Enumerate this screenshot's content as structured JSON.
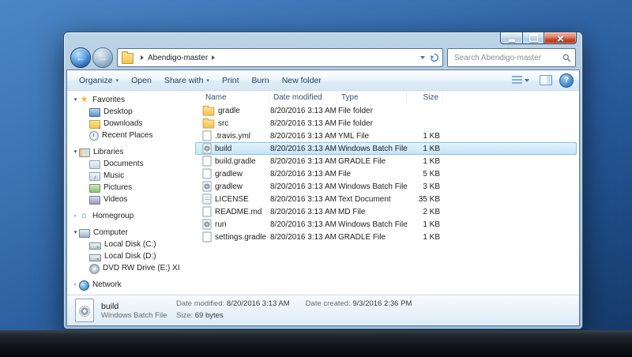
{
  "theme": {
    "desktop_top": "#4a86c6",
    "desktop_bottom": "#143763",
    "window_glass": "#a7c4da",
    "selection_fill": "#c5e5f8",
    "selection_border": "#8ac2e8",
    "close_button_red": "#cf4f30",
    "taskbar_dark": "#0a0f14"
  },
  "navbar": {
    "breadcrumb_item": "Abendigo-master",
    "search_placeholder": "Search Abendigo-master"
  },
  "commandbar": {
    "items": [
      {
        "label": "Organize",
        "dropdown": true
      },
      {
        "label": "Open",
        "dropdown": false
      },
      {
        "label": "Share with",
        "dropdown": true
      },
      {
        "label": "Print",
        "dropdown": false
      },
      {
        "label": "Burn",
        "dropdown": false
      },
      {
        "label": "New folder",
        "dropdown": false
      }
    ],
    "help_label": "?"
  },
  "sidebar": {
    "items": [
      {
        "label": "Favorites",
        "level": 0,
        "icon": "star",
        "expander": "expanded"
      },
      {
        "label": "Desktop",
        "level": 1,
        "icon": "desktop"
      },
      {
        "label": "Downloads",
        "level": 1,
        "icon": "downloads"
      },
      {
        "label": "Recent Places",
        "level": 1,
        "icon": "recent"
      },
      {
        "label": "Libraries",
        "level": 0,
        "icon": "libraries",
        "expander": "expanded"
      },
      {
        "label": "Documents",
        "level": 1,
        "icon": "documents"
      },
      {
        "label": "Music",
        "level": 1,
        "icon": "music"
      },
      {
        "label": "Pictures",
        "level": 1,
        "icon": "pictures"
      },
      {
        "label": "Videos",
        "level": 1,
        "icon": "videos"
      },
      {
        "label": "Homegroup",
        "level": 0,
        "icon": "homegroup",
        "expander": "collapsed"
      },
      {
        "label": "Computer",
        "level": 0,
        "icon": "computer",
        "expander": "expanded"
      },
      {
        "label": "Local Disk (C:)",
        "level": 1,
        "icon": "drive"
      },
      {
        "label": "Local Disk (D:)",
        "level": 1,
        "icon": "drive"
      },
      {
        "label": "DVD RW Drive (E:) XI",
        "level": 1,
        "icon": "dvd"
      },
      {
        "label": "Network",
        "level": 0,
        "icon": "network",
        "expander": "collapsed"
      }
    ]
  },
  "filelist": {
    "columns": [
      {
        "label": "Name"
      },
      {
        "label": "Date modified"
      },
      {
        "label": "Type"
      },
      {
        "label": "Size"
      }
    ],
    "rows": [
      {
        "name": "gradle",
        "date": "8/20/2016 3:13 AM",
        "type": "File folder",
        "size": "",
        "icon": "folder",
        "selected": false
      },
      {
        "name": "src",
        "date": "8/20/2016 3:13 AM",
        "type": "File folder",
        "size": "",
        "icon": "folder",
        "selected": false
      },
      {
        "name": ".travis.yml",
        "date": "8/20/2016 3:13 AM",
        "type": "YML File",
        "size": "1 KB",
        "icon": "file",
        "selected": false
      },
      {
        "name": "build",
        "date": "8/20/2016 3:13 AM",
        "type": "Windows Batch File",
        "size": "1 KB",
        "icon": "batch",
        "selected": true
      },
      {
        "name": "build.gradle",
        "date": "8/20/2016 3:13 AM",
        "type": "GRADLE File",
        "size": "1 KB",
        "icon": "file",
        "selected": false
      },
      {
        "name": "gradlew",
        "date": "8/20/2016 3:13 AM",
        "type": "File",
        "size": "5 KB",
        "icon": "file",
        "selected": false
      },
      {
        "name": "gradlew",
        "date": "8/20/2016 3:13 AM",
        "type": "Windows Batch File",
        "size": "3 KB",
        "icon": "batch",
        "selected": false
      },
      {
        "name": "LICENSE",
        "date": "8/20/2016 3:13 AM",
        "type": "Text Document",
        "size": "35 KB",
        "icon": "text",
        "selected": false
      },
      {
        "name": "README.md",
        "date": "8/20/2016 3:13 AM",
        "type": "MD File",
        "size": "2 KB",
        "icon": "file",
        "selected": false
      },
      {
        "name": "run",
        "date": "8/20/2016 3:13 AM",
        "type": "Windows Batch File",
        "size": "1 KB",
        "icon": "batch",
        "selected": false
      },
      {
        "name": "settings.gradle",
        "date": "8/20/2016 3:13 AM",
        "type": "GRADLE File",
        "size": "1 KB",
        "icon": "file",
        "selected": false
      }
    ]
  },
  "detailspane": {
    "name": "build",
    "type": "Windows Batch File",
    "date_modified_label": "Date modified:",
    "date_modified": "8/20/2016 3:13 AM",
    "size_label": "Size:",
    "size": "69 bytes",
    "date_created_label": "Date created:",
    "date_created": "9/3/2016 2:36 PM"
  }
}
